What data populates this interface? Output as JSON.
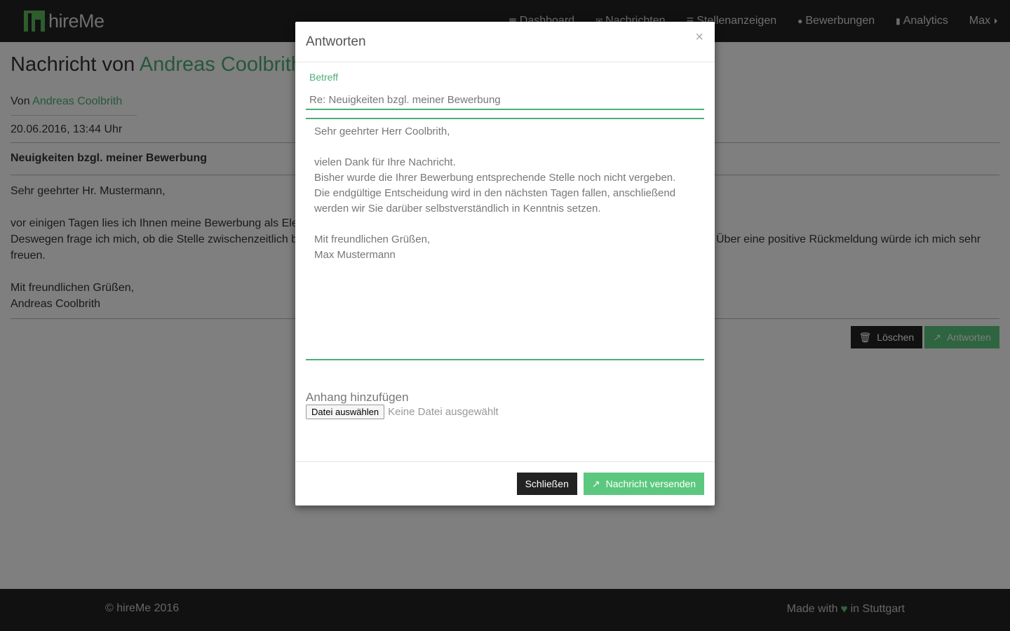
{
  "navbar": {
    "brand": "hireMe",
    "links": [
      {
        "label": "Dashboard",
        "icon": "grid-icon"
      },
      {
        "label": "Nachrichten",
        "icon": "envelope-icon"
      },
      {
        "label": "Stellenanzeigen",
        "icon": "list-icon"
      },
      {
        "label": "Bewerbungen",
        "icon": "user-icon"
      },
      {
        "label": "Analytics",
        "icon": "bar-chart-icon"
      }
    ],
    "user": "Max"
  },
  "page": {
    "title_prefix": "Nachricht von",
    "title_name": "Andreas Coolbrith",
    "from_prefix": "Von",
    "from_name": "Andreas Coolbrith",
    "date": "20.06.2016, 13:44 Uhr",
    "subject": "Neuigkeiten bzgl. meiner Bewerbung",
    "body_lines": [
      "Sehr geehrter Hr. Mustermann,",
      "",
      "vor einigen Tagen lies ich Ihnen meine Bewerbung als Elek",
      "Deswegen frage ich mich, ob die Stelle zwischenzeitlich be",
      "freuen.",
      "",
      "Mit freundlichen Grüßen,",
      "Andreas Coolbrith"
    ],
    "body_line_right": "Über eine positive Rückmeldung würde ich mich sehr",
    "delete_label": "Löschen",
    "reply_label": "Antworten"
  },
  "modal": {
    "title": "Antworten",
    "close_symbol": "×",
    "subject_label": "Betreff",
    "subject_value": "Re: Neuigkeiten bzgl. meiner Bewerbung",
    "body_value": "Sehr geehrter Herr Coolbrith,\n\nvielen Dank für Ihre Nachricht.\nBisher wurde die Ihrer Bewerbung entsprechende Stelle noch nicht vergeben.\nDie endgültige Entscheidung wird in den nächsten Tagen fallen, anschließend werden wir Sie darüber selbstverständlich in Kenntnis setzen.\n\nMit freundlichen Grüßen,\nMax Mustermann",
    "attach_label": "Anhang hinzufügen",
    "file_button": "Datei auswählen",
    "file_status": "Keine Datei ausgewählt",
    "close_button": "Schließen",
    "send_button": "Nachricht versenden"
  },
  "footer": {
    "copyright": "© hireMe 2016",
    "made_with": "Made with",
    "in_city": "in Stuttgart"
  },
  "colors": {
    "accent": "#4caf75",
    "button_green": "#5cc87f",
    "dark": "#222222"
  }
}
